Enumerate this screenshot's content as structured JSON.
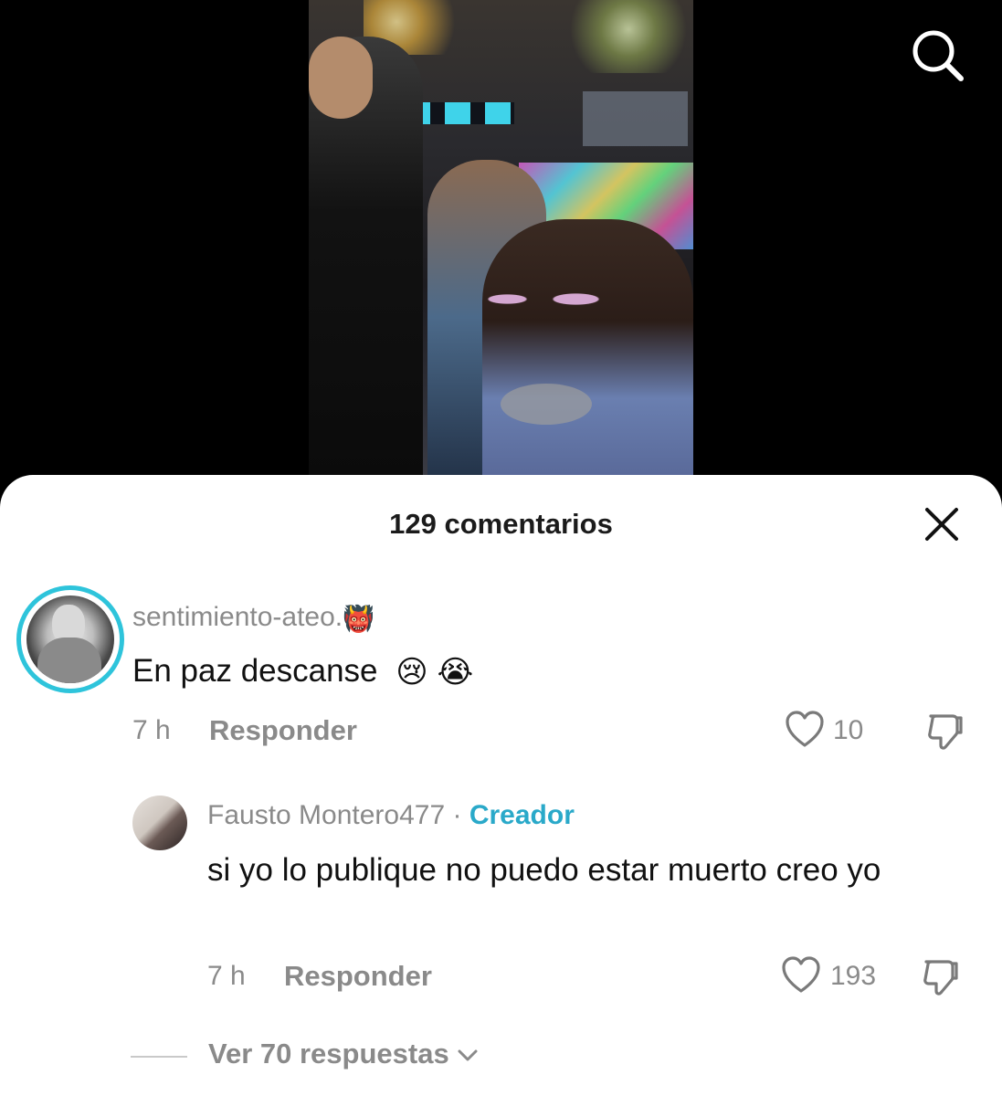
{
  "header": {
    "search_icon": "search-icon"
  },
  "sheet": {
    "title": "129 comentarios",
    "close_icon": "close-icon"
  },
  "comments": [
    {
      "username": "sentimiento-ateo.",
      "username_emoji": "👹",
      "text": "En paz descanse",
      "text_emojis": [
        "😢",
        "😭"
      ],
      "time": "7 h",
      "reply_label": "Responder",
      "likes": "10"
    }
  ],
  "replies": [
    {
      "username": "Fausto Montero477",
      "separator": "·",
      "badge": "Creador",
      "text": "si yo lo publique no puedo estar muerto creo yo",
      "time": "7 h",
      "reply_label": "Responder",
      "likes": "193"
    }
  ],
  "view_replies": "Ver 70 respuestas",
  "colors": {
    "accent_ring": "#2ec4db",
    "creator_badge": "#2aa9c9",
    "muted_text": "#8a8a8a"
  }
}
